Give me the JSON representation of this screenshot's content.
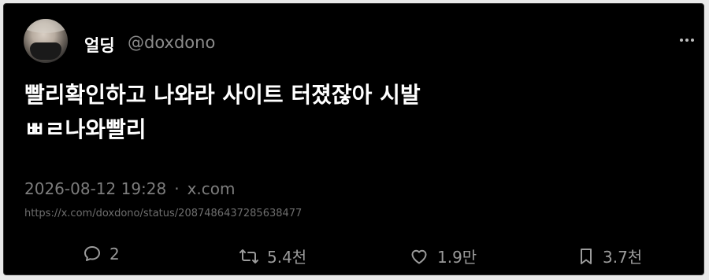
{
  "tweet": {
    "display_name": "얼딩",
    "handle": "@doxdono",
    "text_line1": "빨리확인하고 나와라 사이트 터졌잖아 시발",
    "text_line2": "ㅃㄹ나와빨리",
    "timestamp": "2026-08-12 19:28",
    "separator": "·",
    "source": "x.com",
    "url": "https://x.com/doxdono/status/2087486437285638477"
  },
  "actions": {
    "reply_count": "2",
    "retweet_count": "5.4천",
    "like_count": "1.9만",
    "bookmark_count": "3.7천"
  },
  "icons": {
    "more": "more-horizontal-icon",
    "reply": "speech-bubble-icon",
    "retweet": "retweet-arrows-icon",
    "like": "heart-icon",
    "bookmark": "bookmark-icon"
  },
  "colors": {
    "background": "#000000",
    "text": "#ffffff",
    "muted": "#8b8b8b"
  }
}
